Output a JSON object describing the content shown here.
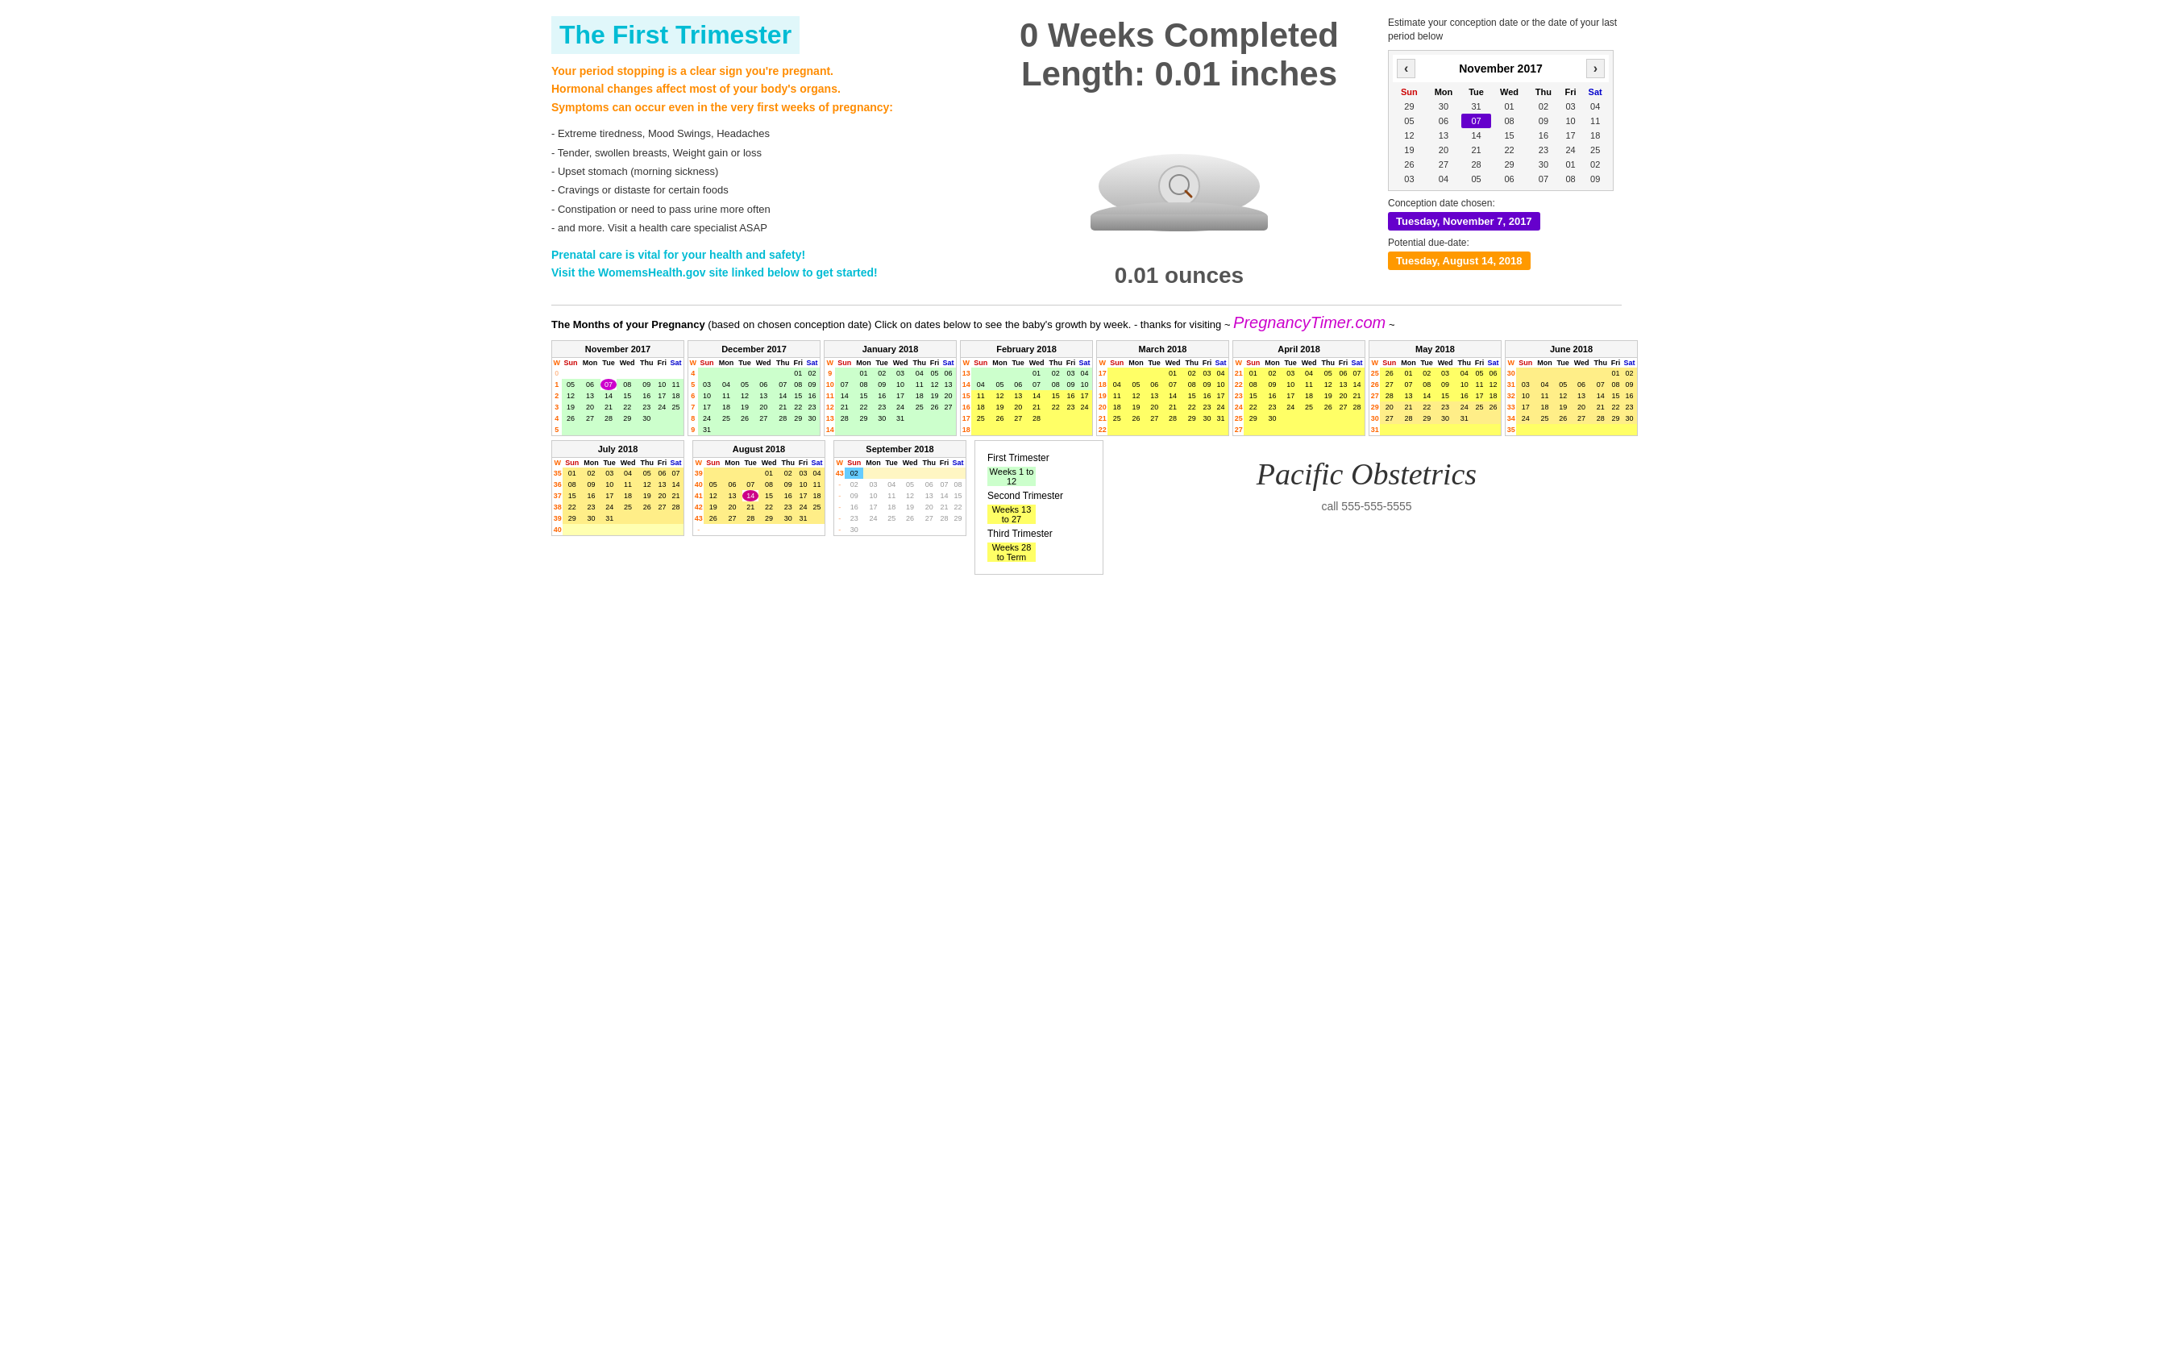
{
  "header": {
    "trimester_title": "The First Trimester",
    "orange_text": "Your period stopping is a clear sign you're pregnant.\nHormonal changes affect most of your body's organs.\nSymptoms can occur even in the very first weeks of pregnancy:",
    "symptoms": [
      "- Extreme tiredness, Mood Swings, Headaches",
      "- Tender, swollen breasts, Weight gain or loss",
      "- Upset stomach (morning sickness)",
      "- Cravings or distaste for certain foods",
      "- Constipation or need to pass urine more often",
      "- and more. Visit a health care specialist ASAP"
    ],
    "prenatal_text": "Prenatal care is vital for your health and safety!\nVisit the WomemsHealth.gov site linked below to get started!",
    "weeks_completed": "0 Weeks Completed",
    "length_label": "Length: 0.01 inches",
    "weight_label": "0.01 ounces"
  },
  "calendar_panel": {
    "estimate_text": "Estimate your conception date or the date of your last period below",
    "month": "November 2017",
    "days_header": [
      "Sun",
      "Mon",
      "Tue",
      "Wed",
      "Thu",
      "Fri",
      "Sat"
    ],
    "weeks": [
      [
        "29",
        "30",
        "31",
        "01",
        "02",
        "03",
        "04"
      ],
      [
        "05",
        "06",
        "07",
        "08",
        "09",
        "10",
        "11"
      ],
      [
        "12",
        "13",
        "14",
        "15",
        "16",
        "17",
        "18"
      ],
      [
        "19",
        "20",
        "21",
        "22",
        "23",
        "24",
        "25"
      ],
      [
        "26",
        "27",
        "28",
        "29",
        "30",
        "01",
        "02"
      ],
      [
        "03",
        "04",
        "05",
        "06",
        "07",
        "08",
        "09"
      ]
    ],
    "selected_day": "07",
    "conception_label": "Conception date chosen:",
    "conception_date": "Tuesday, November 7, 2017",
    "duedate_label": "Potential due-date:",
    "due_date": "Tuesday, August 14, 2018"
  },
  "divider": {
    "main_text": "The Months of your Pregnancy",
    "sub_text": "(based on chosen conception date) Click on dates below to see the baby's growth by week.",
    "thanks_text": "- thanks for visiting ~",
    "site_name": "PregnancyTimer.com",
    "tilde": "~"
  },
  "legend": {
    "first_trimester": "First Trimester",
    "weeks_1_12": "Weeks 1 to 12",
    "second_trimester": "Second Trimester",
    "weeks_13_27": "Weeks 13 to 27",
    "third_trimester": "Third Trimester",
    "weeks_28_term": "Weeks 28 to Term"
  },
  "business": {
    "name": "Pacific Obstetrics",
    "phone": "call 555-555-5555"
  },
  "nav": {
    "prev": "‹",
    "next": "›"
  }
}
